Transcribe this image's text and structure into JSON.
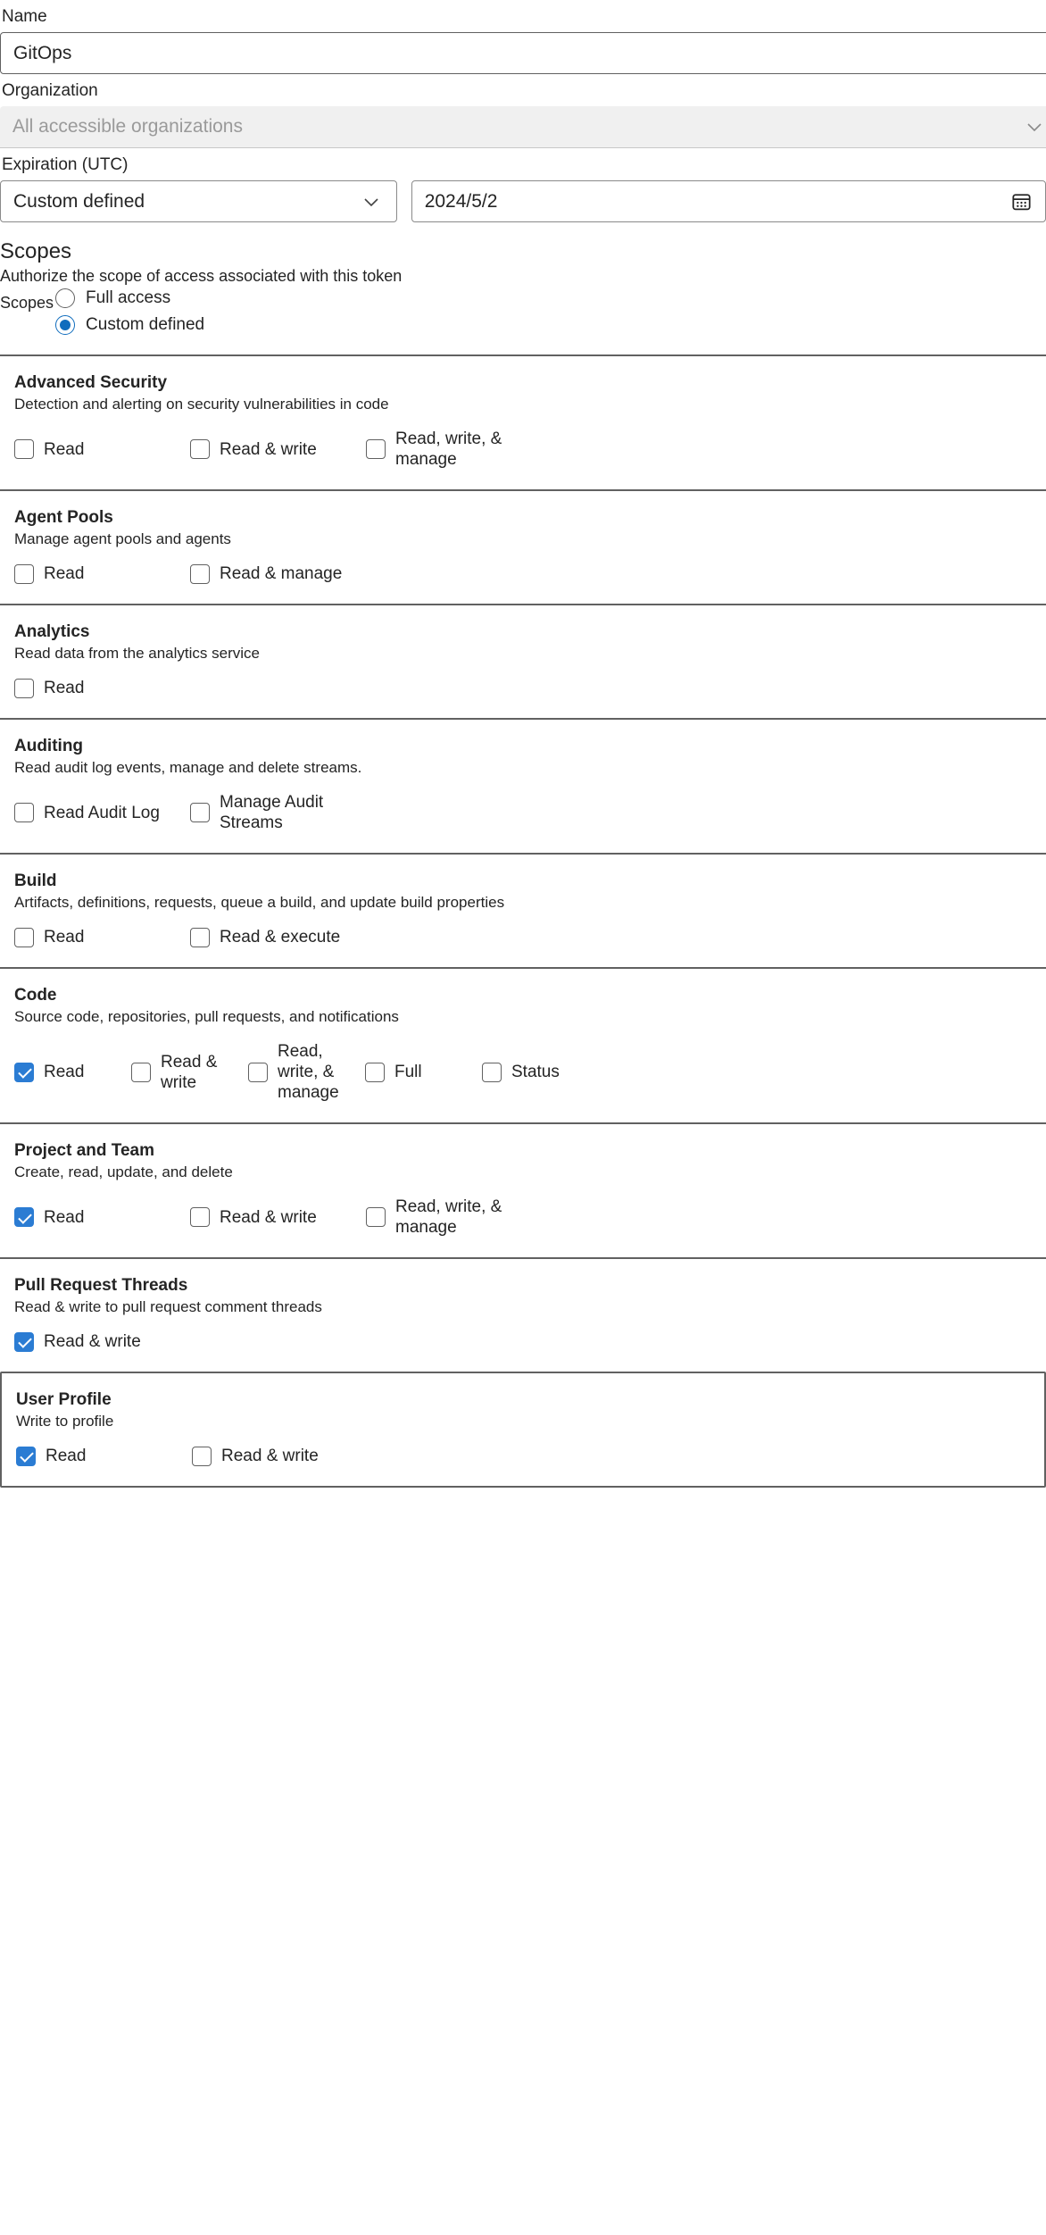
{
  "form": {
    "name_label": "Name",
    "name_value": "GitOps",
    "organization_label": "Organization",
    "organization_value": "All accessible organizations",
    "organization_icon": "chevron-down-icon",
    "expiration_label": "Expiration (UTC)",
    "expiration_select_value": "Custom defined",
    "expiration_select_icon": "chevron-down-icon",
    "expiration_date_value": "2024/5/2",
    "expiration_date_icon": "calendar-icon"
  },
  "scopes": {
    "title": "Scopes",
    "subtitle": "Authorize the scope of access associated with this token",
    "radio_group_label": "Scopes",
    "options": [
      {
        "label": "Full access",
        "checked": false
      },
      {
        "label": "Custom defined",
        "checked": true
      }
    ],
    "accent_color": "#0f6cbd",
    "checkbox_color": "#2b7cd3"
  },
  "sections": [
    {
      "name": "Advanced Security",
      "description": "Detection and alerting on security vulnerabilities in code",
      "focused": false,
      "options": [
        {
          "label": "Read",
          "checked": false
        },
        {
          "label": "Read & write",
          "checked": false
        },
        {
          "label": "Read, write, & manage",
          "checked": false
        }
      ]
    },
    {
      "name": "Agent Pools",
      "description": "Manage agent pools and agents",
      "focused": false,
      "options": [
        {
          "label": "Read",
          "checked": false
        },
        {
          "label": "Read & manage",
          "checked": false
        }
      ]
    },
    {
      "name": "Analytics",
      "description": "Read data from the analytics service",
      "focused": false,
      "options": [
        {
          "label": "Read",
          "checked": false
        }
      ]
    },
    {
      "name": "Auditing",
      "description": "Read audit log events, manage and delete streams.",
      "focused": false,
      "options": [
        {
          "label": "Read Audit Log",
          "checked": false
        },
        {
          "label": "Manage Audit Streams",
          "checked": false
        }
      ]
    },
    {
      "name": "Build",
      "description": "Artifacts, definitions, requests, queue a build, and update build properties",
      "focused": false,
      "options": [
        {
          "label": "Read",
          "checked": false
        },
        {
          "label": "Read & execute",
          "checked": false
        }
      ]
    },
    {
      "name": "Code",
      "description": "Source code, repositories, pull requests, and notifications",
      "focused": false,
      "options": [
        {
          "label": "Read",
          "checked": true
        },
        {
          "label": "Read & write",
          "checked": false
        },
        {
          "label": "Read, write, & manage",
          "checked": false
        },
        {
          "label": "Full",
          "checked": false
        },
        {
          "label": "Status",
          "checked": false
        }
      ]
    },
    {
      "name": "Project and Team",
      "description": "Create, read, update, and delete",
      "focused": false,
      "options": [
        {
          "label": "Read",
          "checked": true
        },
        {
          "label": "Read & write",
          "checked": false
        },
        {
          "label": "Read, write, & manage",
          "checked": false
        }
      ]
    },
    {
      "name": "Pull Request Threads",
      "description": "Read & write to pull request comment threads",
      "focused": false,
      "options": [
        {
          "label": "Read & write",
          "checked": true
        }
      ]
    },
    {
      "name": "User Profile",
      "description": "Write to profile",
      "focused": true,
      "options": [
        {
          "label": "Read",
          "checked": true
        },
        {
          "label": "Read & write",
          "checked": false
        }
      ]
    }
  ]
}
